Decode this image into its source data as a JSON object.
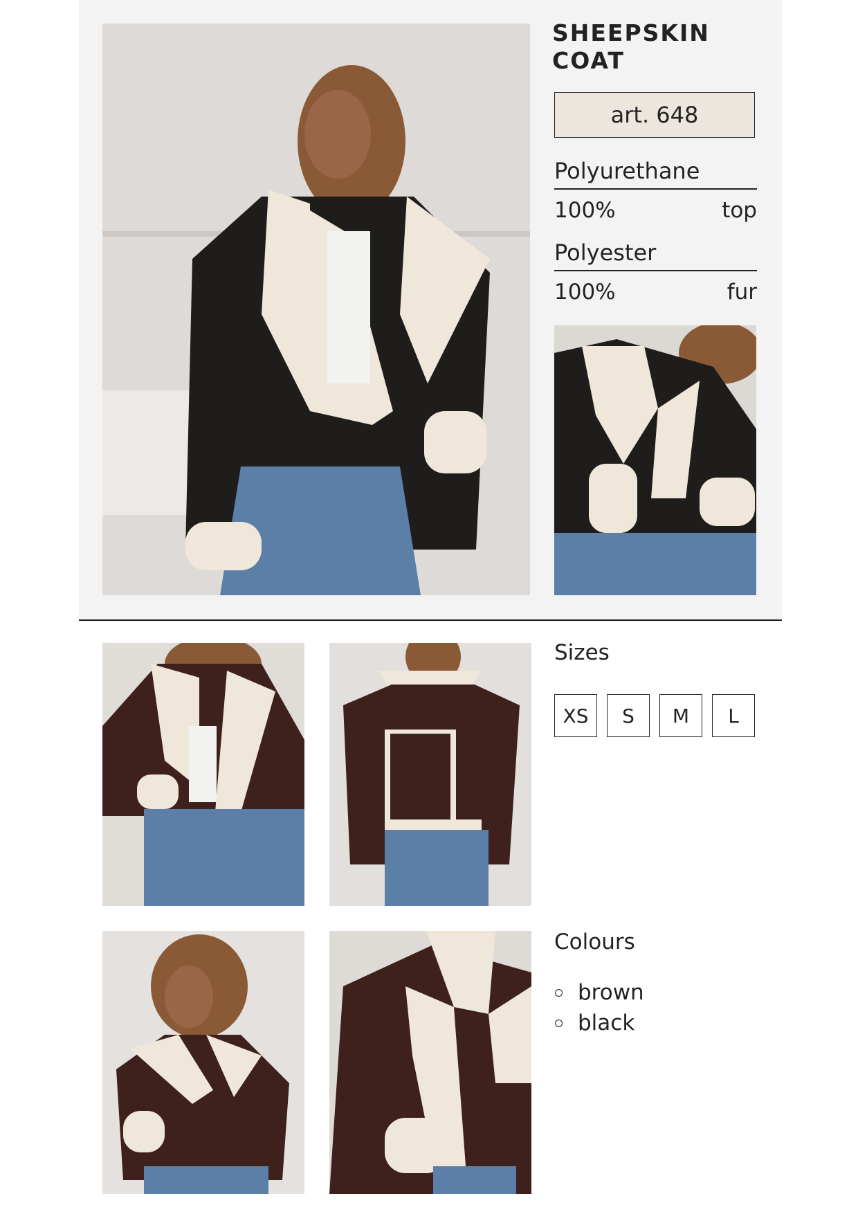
{
  "product": {
    "title_line1": "SHEEPSKIN",
    "title_line2": "COAT",
    "article": "art. 648"
  },
  "composition": [
    {
      "material": "Polyurethane",
      "percent": "100%",
      "part": "top"
    },
    {
      "material": "Polyester",
      "percent": "100%",
      "part": "fur"
    }
  ],
  "sizes": {
    "label": "Sizes",
    "options": [
      "XS",
      "S",
      "M",
      "L"
    ]
  },
  "colours": {
    "label": "Colours",
    "options": [
      "brown",
      "black"
    ]
  },
  "palette": {
    "panel_bg": "#f3f3f3",
    "article_bg": "#ede6df",
    "jacket_black": "#1f1d1c",
    "jacket_brown": "#3e201c",
    "fur": "#efe7d9",
    "denim": "#5b7fa6"
  }
}
